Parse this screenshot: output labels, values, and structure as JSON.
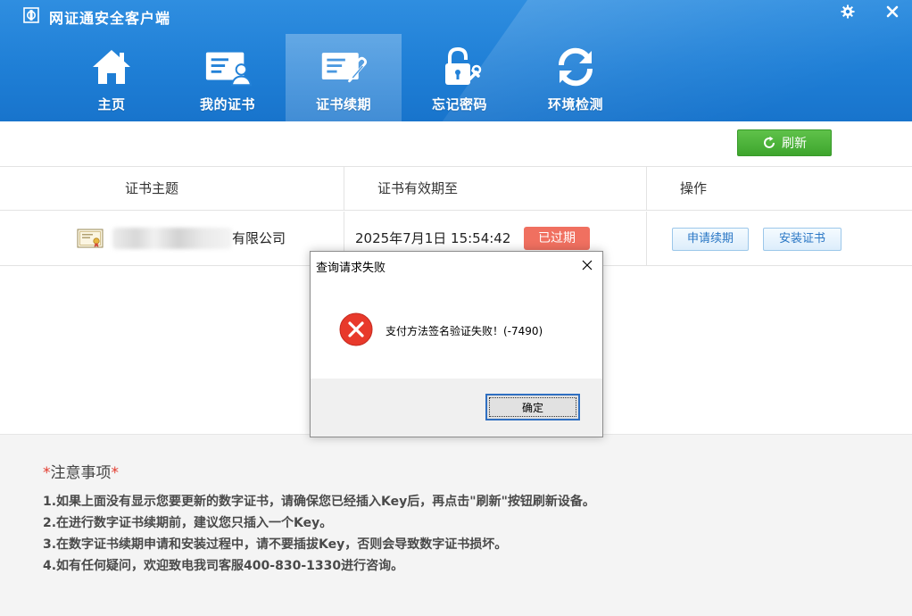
{
  "app": {
    "title": "网证通安全客户端",
    "icons": {
      "logo": "app-logo-icon",
      "settings": "gear-icon",
      "close": "close-icon"
    }
  },
  "nav": {
    "active_index": 2,
    "items": [
      {
        "label": "主页",
        "icon": "home-icon"
      },
      {
        "label": "我的证书",
        "icon": "my-certificate-icon"
      },
      {
        "label": "证书续期",
        "icon": "certificate-renew-icon"
      },
      {
        "label": "忘记密码",
        "icon": "forgot-password-icon"
      },
      {
        "label": "环境检测",
        "icon": "environment-check-icon"
      }
    ]
  },
  "toolbar": {
    "refresh_label": "刷新",
    "refresh_icon": "refresh-icon"
  },
  "table": {
    "headers": [
      "证书主题",
      "证书有效期至",
      "操作"
    ],
    "rows": [
      {
        "subject_suffix": "有限公司",
        "expiry": "2025年7月1日 15:54:42",
        "status": "已过期",
        "actions": [
          "申请续期",
          "安装证书"
        ]
      }
    ]
  },
  "notes": {
    "title": "注意事项",
    "star": "*",
    "lines": [
      "1.如果上面没有显示您要更新的数字证书，请确保您已经插入Key后，再点击\"刷新\"按钮刷新设备。",
      "2.在进行数字证书续期前，建议您只插入一个Key。",
      "3.在数字证书续期申请和安装过程中，请不要插拔Key，否则会导致数字证书损坏。",
      "4.如有任何疑问，欢迎致电我司客服400-830-1330进行咨询。"
    ]
  },
  "dialog": {
    "title": "查询请求失败",
    "message": "支付方法签名验证失败！(-7490)",
    "ok_label": "确定",
    "icon": "error-icon"
  },
  "colors": {
    "header_blue": "#1f7fd6",
    "refresh_green": "#3ea52d",
    "expired_red": "#f07060",
    "note_star_red": "#e23b2e"
  }
}
